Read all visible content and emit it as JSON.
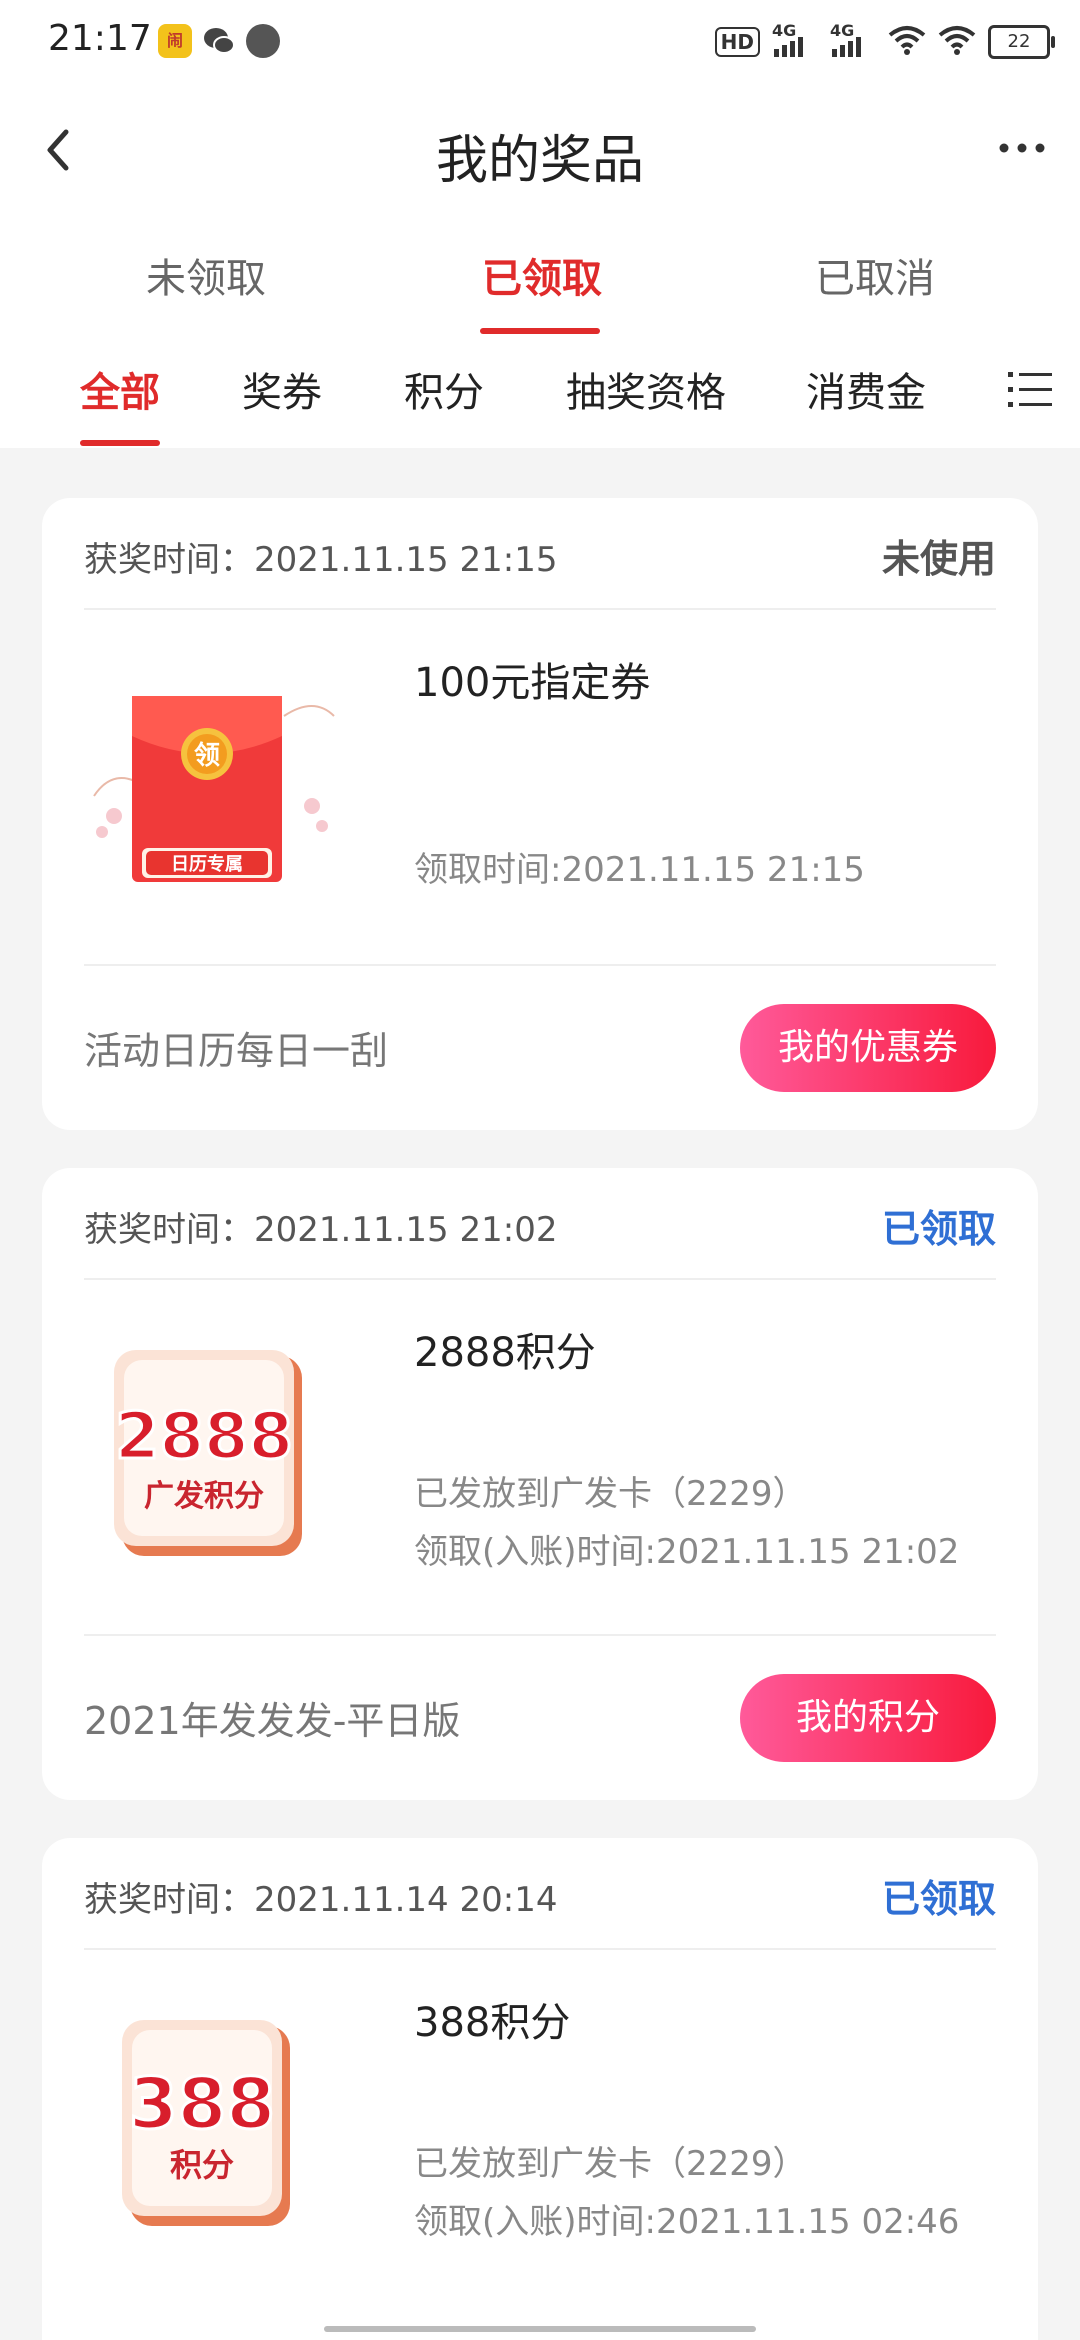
{
  "status_bar": {
    "time": "21:17",
    "app_icon_label": "闹",
    "hd_label": "HD",
    "network_1": "4G",
    "network_2": "4G",
    "battery": "22"
  },
  "header": {
    "title": "我的奖品",
    "back_icon": "back-chevron-icon",
    "more_icon": "more-dots-icon"
  },
  "status_tabs": [
    {
      "label": "未领取"
    },
    {
      "label": "已领取"
    },
    {
      "label": "已取消"
    }
  ],
  "category_tabs": [
    {
      "label": "全部"
    },
    {
      "label": "奖券"
    },
    {
      "label": "积分"
    },
    {
      "label": "抽奖资格"
    },
    {
      "label": "消费金"
    }
  ],
  "colors": {
    "accent": "#e02b2b",
    "status_blue": "#2f6fd4",
    "button_gradient_start": "#ff5a9a",
    "button_gradient_end": "#f81a3c"
  },
  "cards": [
    {
      "award_time": "获奖时间：2021.11.15 21:15",
      "status": "未使用",
      "name": "100元指定券",
      "image": {
        "type": "red-envelope",
        "badge": "领",
        "ribbon": "日历专属"
      },
      "claim_time": "领取时间:2021.11.15 21:15",
      "activity": "活动日历每日一刮",
      "button": "我的优惠券"
    },
    {
      "award_time": "获奖时间：2021.11.15 21:02",
      "status": "已领取",
      "name": "2888积分",
      "image": {
        "type": "points-tile",
        "big": "2888",
        "small": "广发积分"
      },
      "delivered": "已发放到广发卡（2229）",
      "claim_time": "领取(入账)时间:2021.11.15 21:02",
      "activity": "2021年发发发-平日版",
      "button": "我的积分"
    },
    {
      "award_time": "获奖时间：2021.11.14 20:14",
      "status": "已领取",
      "name": "388积分",
      "image": {
        "type": "points-tile",
        "big": "388",
        "small": "积分"
      },
      "delivered": "已发放到广发卡（2229）",
      "claim_time": "领取(入账)时间:2021.11.15 02:46"
    }
  ]
}
